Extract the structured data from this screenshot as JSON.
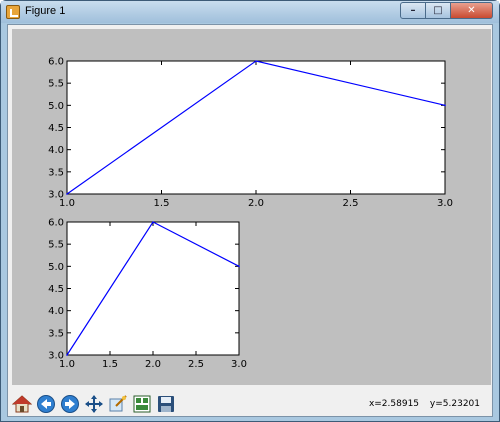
{
  "window": {
    "title": "Figure 1",
    "minimize": "–",
    "maximize": "□",
    "close": "✕"
  },
  "toolbar": {
    "buttons": [
      "home-icon",
      "back-arrow-icon",
      "forward-arrow-icon",
      "pan-icon",
      "zoom-icon",
      "subplots-icon",
      "save-icon"
    ],
    "x_readout": "x=2.58915",
    "y_readout": "y=5.23201"
  },
  "chart_data": [
    {
      "type": "line",
      "x": [
        1.0,
        2.0,
        3.0
      ],
      "values": [
        3.0,
        6.0,
        5.0
      ],
      "xlim": [
        1.0,
        3.0
      ],
      "ylim": [
        3.0,
        6.0
      ],
      "xticks": [
        "1.0",
        "1.5",
        "2.0",
        "2.5",
        "3.0"
      ],
      "yticks": [
        "3.0",
        "3.5",
        "4.0",
        "4.5",
        "5.0",
        "5.5",
        "6.0"
      ],
      "color": "#0000ff",
      "grid": false
    },
    {
      "type": "line",
      "x": [
        1.0,
        2.0,
        3.0
      ],
      "values": [
        3.0,
        6.0,
        5.0
      ],
      "xlim": [
        1.0,
        3.0
      ],
      "ylim": [
        3.0,
        6.0
      ],
      "xticks": [
        "1.0",
        "1.5",
        "2.0",
        "2.5",
        "3.0"
      ],
      "yticks": [
        "3.0",
        "3.5",
        "4.0",
        "4.5",
        "5.0",
        "5.5",
        "6.0"
      ],
      "color": "#0000ff",
      "grid": false
    }
  ]
}
